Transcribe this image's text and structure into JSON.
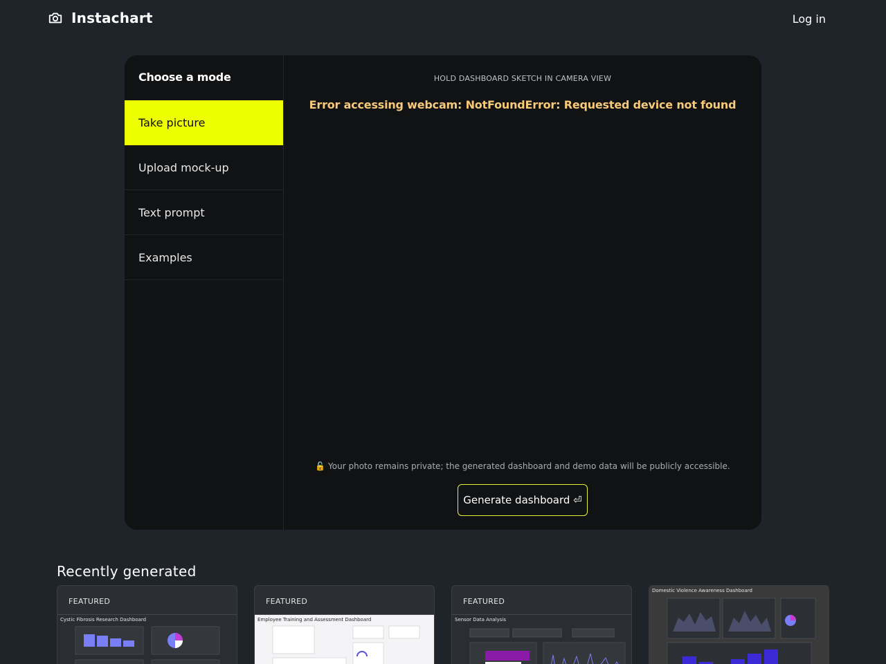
{
  "header": {
    "brand": "Instachart",
    "login_label": "Log in"
  },
  "sidebar": {
    "title": "Choose a mode",
    "items": [
      {
        "label": "Take picture",
        "active": true
      },
      {
        "label": "Upload mock-up",
        "active": false
      },
      {
        "label": "Text prompt",
        "active": false
      },
      {
        "label": "Examples",
        "active": false
      }
    ]
  },
  "camera": {
    "instruction": "HOLD DASHBOARD SKETCH IN CAMERA VIEW",
    "error": "Error accessing webcam: NotFoundError: Requested device not found",
    "privacy": "🔓 Your photo remains private; the generated dashboard and demo data will be publicly accessible.",
    "generate_label": "Generate dashboard ⏎"
  },
  "recent": {
    "title": "Recently generated",
    "cards": [
      {
        "badge": "FEATURED",
        "title": "Cystic Fibrosis Research Dashboard"
      },
      {
        "badge": "FEATURED",
        "title": "Employee Training and Assessment Dashboard"
      },
      {
        "badge": "FEATURED",
        "title": "Sensor Data Analysis"
      },
      {
        "badge": "",
        "title": "Domestic Violence Awareness Dashboard"
      }
    ]
  },
  "colors": {
    "background": "#1f242b",
    "panel": "#111213",
    "accent": "#eeff00",
    "error": "#f7c97a"
  }
}
